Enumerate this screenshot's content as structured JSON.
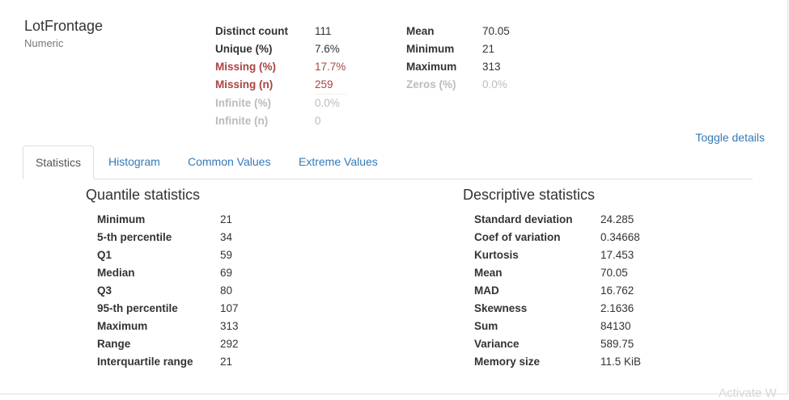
{
  "variable": {
    "name": "LotFrontage",
    "type": "Numeric"
  },
  "overview_left": [
    {
      "label": "Distinct count",
      "value": "111",
      "state": "normal"
    },
    {
      "label": "Unique (%)",
      "value": "7.6%",
      "state": "normal"
    },
    {
      "label": "Missing (%)",
      "value": "17.7%",
      "state": "alert"
    },
    {
      "label": "Missing (n)",
      "value": "259",
      "state": "alert"
    },
    {
      "label": "Infinite (%)",
      "value": "0.0%",
      "state": "ignore"
    },
    {
      "label": "Infinite (n)",
      "value": "0",
      "state": "ignore"
    }
  ],
  "overview_right": [
    {
      "label": "Mean",
      "value": "70.05",
      "state": "normal"
    },
    {
      "label": "Minimum",
      "value": "21",
      "state": "normal"
    },
    {
      "label": "Maximum",
      "value": "313",
      "state": "normal"
    },
    {
      "label": "Zeros (%)",
      "value": "0.0%",
      "state": "ignore"
    }
  ],
  "toggle_label": "Toggle details",
  "tabs": [
    {
      "label": "Statistics",
      "active": true
    },
    {
      "label": "Histogram",
      "active": false
    },
    {
      "label": "Common Values",
      "active": false
    },
    {
      "label": "Extreme Values",
      "active": false
    }
  ],
  "quantile": {
    "title": "Quantile statistics",
    "rows": [
      {
        "label": "Minimum",
        "value": "21"
      },
      {
        "label": "5-th percentile",
        "value": "34"
      },
      {
        "label": "Q1",
        "value": "59"
      },
      {
        "label": "Median",
        "value": "69"
      },
      {
        "label": "Q3",
        "value": "80"
      },
      {
        "label": "95-th percentile",
        "value": "107"
      },
      {
        "label": "Maximum",
        "value": "313"
      },
      {
        "label": "Range",
        "value": "292"
      },
      {
        "label": "Interquartile range",
        "value": "21"
      }
    ]
  },
  "descriptive": {
    "title": "Descriptive statistics",
    "rows": [
      {
        "label": "Standard deviation",
        "value": "24.285"
      },
      {
        "label": "Coef of variation",
        "value": "0.34668"
      },
      {
        "label": "Kurtosis",
        "value": "17.453"
      },
      {
        "label": "Mean",
        "value": "70.05"
      },
      {
        "label": "MAD",
        "value": "16.762"
      },
      {
        "label": "Skewness",
        "value": "2.1636"
      },
      {
        "label": "Sum",
        "value": "84130"
      },
      {
        "label": "Variance",
        "value": "589.75"
      },
      {
        "label": "Memory size",
        "value": "11.5 KiB"
      }
    ]
  },
  "watermark": "Activate W",
  "colors": {
    "link": "#337ab7",
    "alert": "#a94442",
    "muted": "#bbbbbb"
  }
}
